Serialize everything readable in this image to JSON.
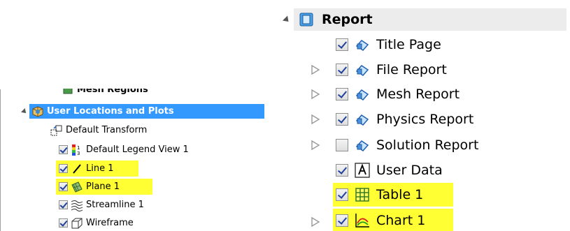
{
  "left_tree": {
    "partial_item": "Mesh Regions",
    "header": "User Locations and Plots",
    "items": [
      {
        "label": "Default Transform",
        "icon": "transform-icon",
        "checkbox": false,
        "highlight": false
      },
      {
        "label": "Default Legend View 1",
        "icon": "legend-icon",
        "checkbox": true,
        "checked": true,
        "highlight": false
      },
      {
        "label": "Line 1",
        "icon": "line-icon",
        "checkbox": true,
        "checked": true,
        "highlight": true
      },
      {
        "label": "Plane 1",
        "icon": "plane-icon",
        "checkbox": true,
        "checked": true,
        "highlight": true
      },
      {
        "label": "Streamline 1",
        "icon": "streamline-icon",
        "checkbox": true,
        "checked": true,
        "highlight": false
      },
      {
        "label": "Wireframe",
        "icon": "wireframe-icon",
        "checkbox": true,
        "checked": true,
        "highlight": false
      }
    ]
  },
  "right_tree": {
    "header": "Report",
    "items": [
      {
        "label": "Title Page",
        "icon": "report-page-icon",
        "checked": true,
        "expandable": false,
        "highlight": false
      },
      {
        "label": "File Report",
        "icon": "report-page-icon",
        "checked": true,
        "expandable": true,
        "highlight": false
      },
      {
        "label": "Mesh Report",
        "icon": "report-page-icon",
        "checked": true,
        "expandable": true,
        "highlight": false
      },
      {
        "label": "Physics Report",
        "icon": "report-page-icon",
        "checked": true,
        "expandable": true,
        "highlight": false
      },
      {
        "label": "Solution Report",
        "icon": "report-page-icon",
        "checked": false,
        "expandable": true,
        "highlight": false
      },
      {
        "label": "User Data",
        "icon": "user-data-icon",
        "checked": true,
        "expandable": false,
        "highlight": false
      },
      {
        "label": "Table 1",
        "icon": "table-icon",
        "checked": true,
        "expandable": false,
        "highlight": true
      },
      {
        "label": "Chart 1",
        "icon": "chart-icon",
        "checked": true,
        "expandable": true,
        "highlight": true
      }
    ]
  },
  "colors": {
    "selection_blue": "#3399ff",
    "highlight_yellow": "#ffff33",
    "header_gray": "#ececec"
  }
}
